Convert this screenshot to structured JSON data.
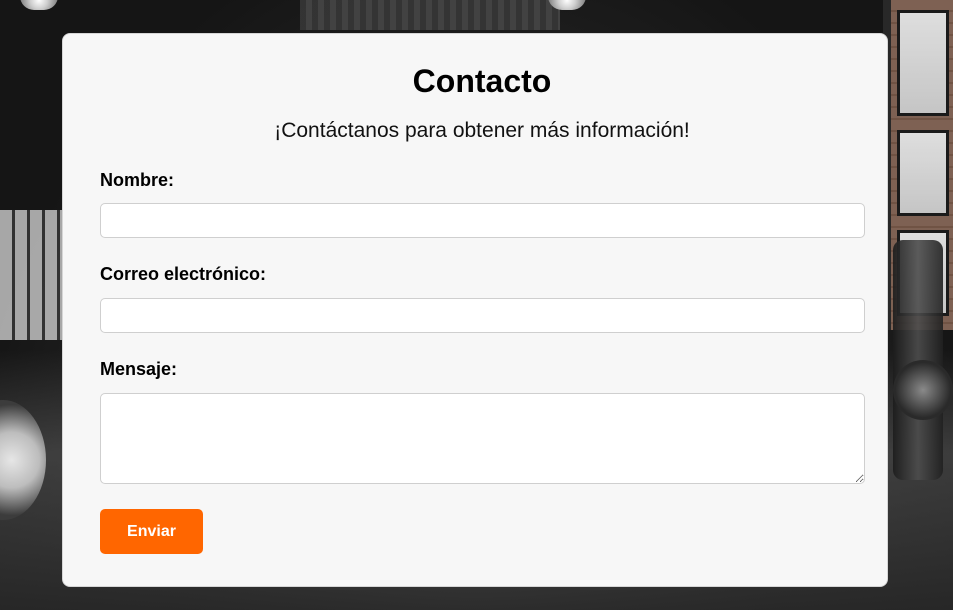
{
  "contact": {
    "title": "Contacto",
    "subtitle": "¡Contáctanos para obtener más información!",
    "fields": {
      "name_label": "Nombre:",
      "name_value": "",
      "email_label": "Correo electrónico:",
      "email_value": "",
      "message_label": "Mensaje:",
      "message_value": ""
    },
    "submit_label": "Enviar"
  },
  "colors": {
    "accent": "#ff6600",
    "card_background": "#f7f7f7"
  }
}
